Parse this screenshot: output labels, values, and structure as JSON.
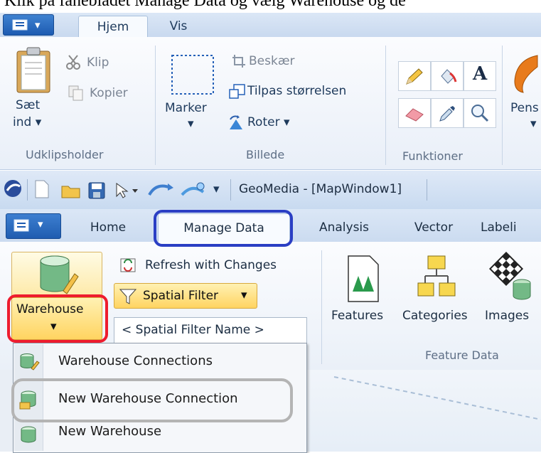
{
  "caption": "Klik på fanebladet Manage Data og vælg Warehouse og de",
  "paint": {
    "menu_arrow": "▾",
    "tabs": [
      {
        "label": "Hjem",
        "active": true
      },
      {
        "label": "Vis",
        "active": false
      }
    ],
    "clipboard": {
      "paste_line1": "Sæt",
      "paste_line2": "ind",
      "paste_arrow": "▾",
      "cut": "Klip",
      "copy": "Kopier",
      "group": "Udklipsholder"
    },
    "image": {
      "select": "Marker",
      "select_arrow": "▾",
      "crop": "Beskær",
      "resize": "Tilpas størrelsen",
      "rotate": "Roter",
      "rotate_arrow": "▾",
      "group": "Billede"
    },
    "tools": {
      "group": "Funktioner",
      "text_glyph": "A"
    },
    "brushes_label": "Pens",
    "brushes_arrow": "▾"
  },
  "geomedia": {
    "title": "GeoMedia - [MapWindow1]",
    "qat_arrow": "▾",
    "tabs": [
      {
        "label": "Home"
      },
      {
        "label": "Manage Data"
      },
      {
        "label": "Analysis"
      },
      {
        "label": "Vector"
      },
      {
        "label": "Labeli"
      }
    ],
    "warehouse_button": "Warehouse",
    "warehouse_arrow": "▾",
    "refresh": "Refresh with Changes",
    "spatial_filter": "Spatial Filter",
    "spatial_filter_arrow": "▾",
    "spatial_filter_name": "< Spatial Filter Name >",
    "features": "Features",
    "categories": "Categories",
    "images": "Images",
    "feature_data_group": "Feature Data"
  },
  "dropdown": {
    "items": [
      "Warehouse Connections",
      "New Warehouse Connection",
      "New Warehouse"
    ]
  },
  "colors": {
    "highlight_blue": "#2b3fc4",
    "highlight_red": "#ee1c2e",
    "highlight_grey": "#b4b4b4"
  }
}
